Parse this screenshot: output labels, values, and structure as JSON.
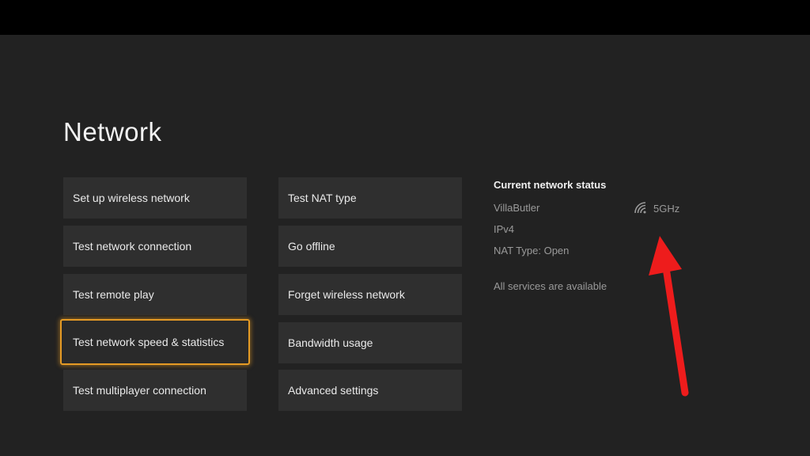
{
  "page": {
    "title": "Network"
  },
  "menu": {
    "left": [
      "Set up wireless network",
      "Test network connection",
      "Test remote play",
      "Test network speed & statistics",
      "Test multiplayer connection"
    ],
    "right": [
      "Test NAT type",
      "Go offline",
      "Forget wireless network",
      "Bandwidth usage",
      "Advanced settings"
    ],
    "focused": "Test network speed & statistics"
  },
  "status": {
    "heading": "Current network status",
    "network_name": "VillaButler",
    "band": "5GHz",
    "band_icon": "wifi-icon",
    "ip_version": "IPv4",
    "nat_type": "NAT Type: Open",
    "services": "All services are available"
  },
  "colors": {
    "background": "#222222",
    "tile": "#2f2f2f",
    "focus": "#e59b25",
    "annotation_arrow": "#ee1c1c"
  }
}
